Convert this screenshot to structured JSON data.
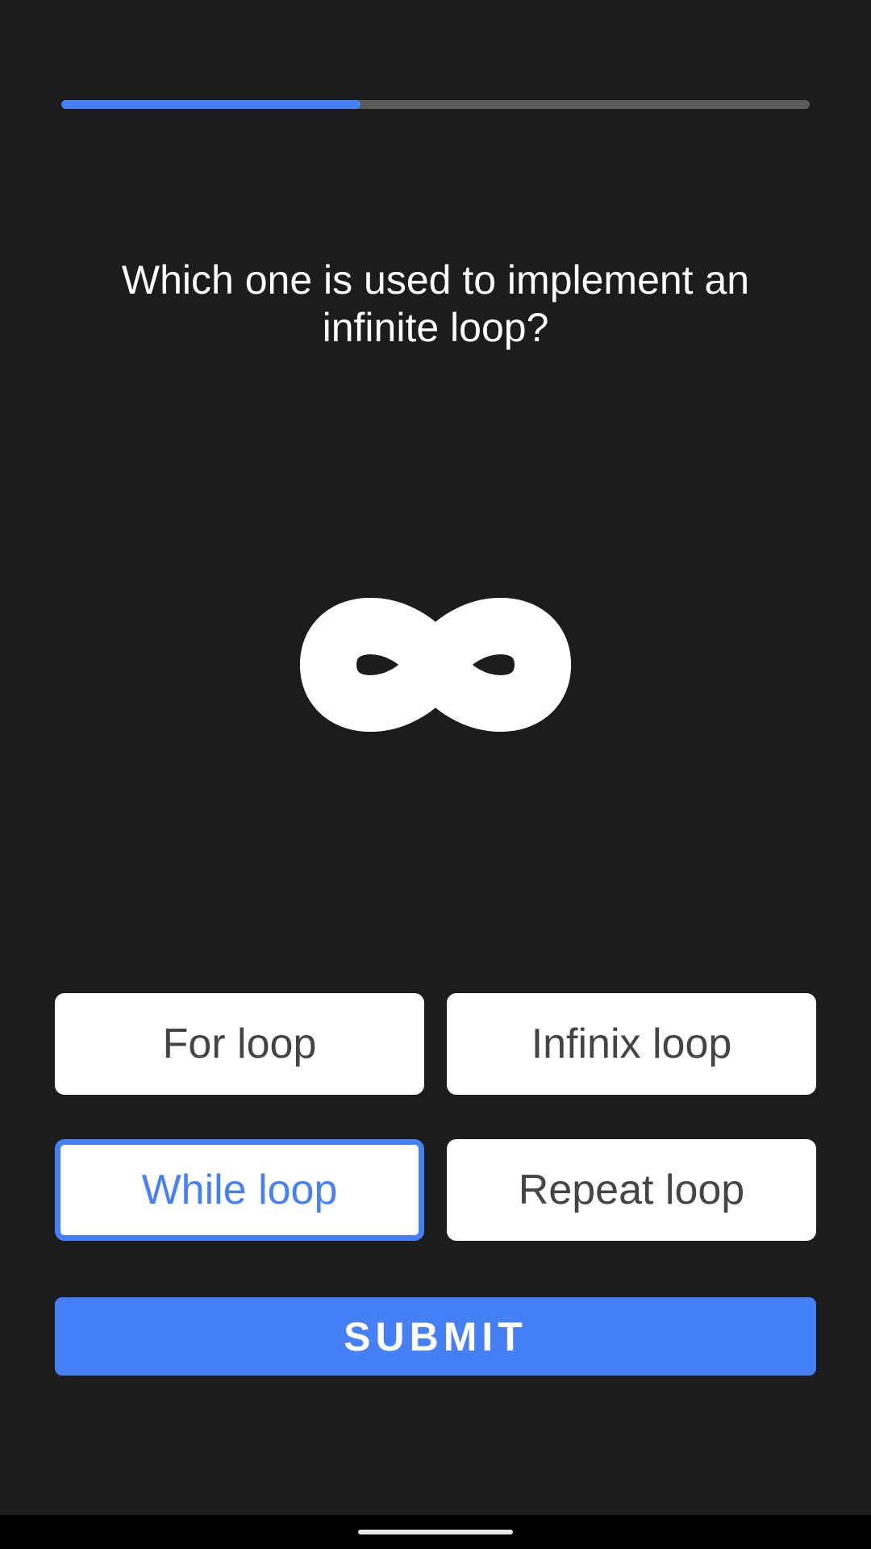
{
  "progress": {
    "value": 0.4
  },
  "question": {
    "text": "Which one is used to implement an infinite loop?"
  },
  "hero": {
    "icon": "infinity-icon"
  },
  "options": [
    {
      "label": "For loop",
      "selected": false
    },
    {
      "label": "Infinix loop",
      "selected": false
    },
    {
      "label": "While loop",
      "selected": true
    },
    {
      "label": "Repeat loop",
      "selected": false
    }
  ],
  "submit": {
    "label": "SUBMIT"
  },
  "colors": {
    "background": "#1c1c1c",
    "accent": "#4680f7",
    "track": "#5a5a5a",
    "option_bg": "#ffffff",
    "option_text": "#444444"
  }
}
